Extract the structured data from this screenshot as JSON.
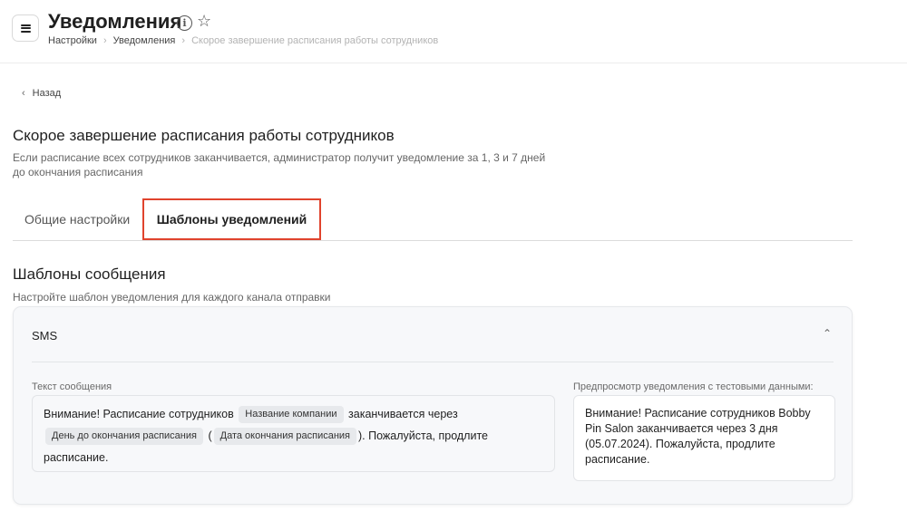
{
  "header": {
    "title": "Уведомления",
    "breadcrumb": [
      "Настройки",
      "Уведомления",
      "Скорое завершение расписания работы сотрудников"
    ]
  },
  "back": {
    "label": "Назад"
  },
  "section": {
    "title": "Скорое завершение расписания работы сотрудников",
    "description": "Если расписание всех сотрудников заканчивается, администратор получит уведомление за 1, 3 и 7 дней до окончания расписания"
  },
  "tabs": [
    {
      "label": "Общие настройки",
      "active": false
    },
    {
      "label": "Шаблоны уведомлений",
      "active": true
    }
  ],
  "templates": {
    "title": "Шаблоны сообщения",
    "description": "Настройте шаблон уведомления для каждого канала отправки"
  },
  "sms_card": {
    "title": "SMS",
    "message_label": "Текст сообщения",
    "message": {
      "part1": "Внимание! Расписание сотрудников",
      "chip_company": "Название компании",
      "part2": "заканчивается через",
      "chip_days": "День до окончания расписания",
      "part3": "(",
      "chip_date": "Дата окончания расписания",
      "part4": "). Пожалуйста, продлите расписание."
    },
    "preview_label": "Предпросмотр уведомления с тестовыми данными:",
    "preview_text": "Внимание! Расписание сотрудников Bobby Pin Salon заканчивается через 3 дня (05.07.2024). Пожалуйста, продлите расписание."
  },
  "colors": {
    "highlight": "#e0432d"
  },
  "icons": [
    "menu-icon",
    "info-icon",
    "star-icon",
    "chevron-left-icon",
    "chevron-right-icon",
    "chevron-up-icon"
  ]
}
